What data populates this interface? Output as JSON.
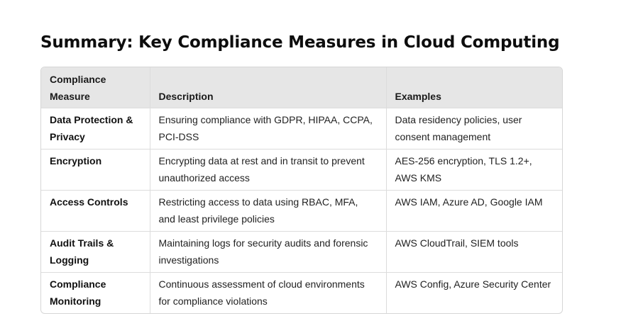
{
  "page": {
    "title": "Summary: Key Compliance Measures in Cloud Computing"
  },
  "table": {
    "headers": {
      "measure": "Compliance Measure",
      "description": "Description",
      "examples": "Examples"
    },
    "rows": [
      {
        "measure": "Data Protection & Privacy",
        "description": "Ensuring compliance with GDPR, HIPAA, CCPA, PCI-DSS",
        "examples": "Data residency policies, user consent management"
      },
      {
        "measure": "Encryption",
        "description": "Encrypting data at rest and in transit to prevent unauthorized access",
        "examples": "AES-256 encryption, TLS 1.2+, AWS KMS"
      },
      {
        "measure": "Access Controls",
        "description": "Restricting access to data using RBAC, MFA, and least privilege policies",
        "examples": "AWS IAM, Azure AD, Google IAM"
      },
      {
        "measure": "Audit Trails & Logging",
        "description": "Maintaining logs for security audits and forensic investigations",
        "examples": "AWS CloudTrail, SIEM tools"
      },
      {
        "measure": "Compliance Monitoring",
        "description": "Continuous assessment of cloud environments for compliance violations",
        "examples": "AWS Config, Azure Security Center"
      }
    ]
  }
}
